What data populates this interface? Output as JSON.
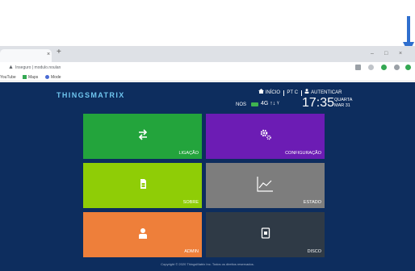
{
  "colors": {
    "app_background": "#0d2d5e",
    "ligacao": "#23a43c",
    "configuracao": "#6c1cb4",
    "sobre": "#8fcd06",
    "estado": "#7d7d7d",
    "admin": "#ee7f3a",
    "disco": "#2f3a46",
    "logo": "#6fc5ef",
    "battery": "#3fb34f",
    "annotation_arrow": "#2f6fce"
  },
  "browser": {
    "tab_close": "×",
    "new_tab": "+",
    "window_minimize": "–",
    "window_maximize": "□",
    "window_close": "×",
    "address": "Inseguro | modulo.noulan",
    "bookmarks": [
      {
        "label": "YouTube",
        "icon": "youtube-icon"
      },
      {
        "label": "Maps",
        "icon": "maps-icon"
      },
      {
        "label": "Mode",
        "icon": "mode-icon"
      }
    ]
  },
  "app": {
    "logo": "THINGSMATRIX",
    "nav": {
      "inicio": "INÍCIO",
      "language": "PT",
      "refresh": "C",
      "login": "AUTENTICAR"
    },
    "status": {
      "network": "NOS",
      "signal": "4G ↑↓ ᵞ",
      "time": "17:35",
      "day": "QUARTA",
      "date": "MAR 31"
    },
    "tiles": [
      {
        "label": "LIGAÇÃO",
        "icon": "transfer-arrows-icon"
      },
      {
        "label": "CONFIGURAÇÃO",
        "icon": "gears-icon"
      },
      {
        "label": "SOBRE",
        "icon": "sim-card-icon"
      },
      {
        "label": "ESTADO",
        "icon": "line-chart-icon"
      },
      {
        "label": "ADMIN",
        "icon": "user-icon"
      },
      {
        "label": "DISCO",
        "icon": "sd-card-icon"
      }
    ],
    "footer": "Copyright © 2020 ThingsMatrix Inc. Todos os direitos reservados."
  }
}
